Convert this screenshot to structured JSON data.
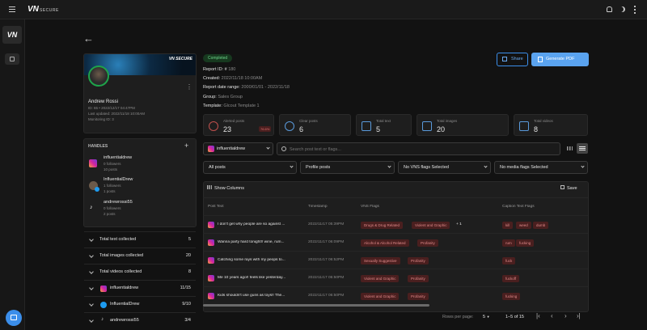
{
  "brand": {
    "logo": "VN",
    "sub": "SECURE"
  },
  "header": {
    "icons": [
      "bell-icon",
      "moon-icon",
      "menu-icon"
    ]
  },
  "nav": {
    "logo": "VN"
  },
  "report": {
    "status": "Completed",
    "id_label": "Report ID: #",
    "id": "180",
    "created_label": "Created:",
    "created": "2022/11/18 10:00AM",
    "range_label": "Report date range:",
    "range": "2000/01/01 - 2022/11/18",
    "group_label": "Group:",
    "group": "Sales Group",
    "template_label": "Template:",
    "template": "Glcout Template 1"
  },
  "buttons": {
    "share": "Share",
    "pdf": "Generate PDF"
  },
  "profile": {
    "banner_logo": "VN SECURE",
    "name": "Andrew Rossi",
    "id_line": "ID: 65 • 2022/12/17 04:47PM",
    "updated": "Last updated: 2022/11/18 10:00AM",
    "monitoring": "Monitoring ID: 3"
  },
  "handles": {
    "title": "HANDLES",
    "items": [
      {
        "name": "influentialdrew",
        "followers": "0 followers",
        "posts": "10 posts"
      },
      {
        "name": "InfluentialDrew",
        "followers": "1 followers",
        "posts": "1 posts"
      },
      {
        "name": "andrewrossi55",
        "followers": "0 followers",
        "posts": "2 posts"
      }
    ]
  },
  "summary": [
    {
      "label": "Total text collected",
      "value": "5"
    },
    {
      "label": "Total images collected",
      "value": "20"
    },
    {
      "label": "Total videos collected",
      "value": "8"
    },
    {
      "label": "influentialdrew",
      "value": "11/15"
    },
    {
      "label": "InfluentialDrew",
      "value": "9/10"
    },
    {
      "label": "andrewrossi55",
      "value": "3/4"
    }
  ],
  "stats": [
    {
      "label": "Alerted posts",
      "value": "23",
      "badge": "76.6%"
    },
    {
      "label": "Clear posts",
      "value": "6"
    },
    {
      "label": "Total text",
      "value": "5"
    },
    {
      "label": "Total images",
      "value": "20"
    },
    {
      "label": "Total videos",
      "value": "8"
    }
  ],
  "filters": {
    "account": "influentialdrew",
    "search_placeholder": "Search post text or flags...",
    "posts": "All posts",
    "profile": "Profile posts",
    "vns": "No VNS flags Selected",
    "media": "No media flags Selected"
  },
  "table": {
    "show_columns": "Show Columns",
    "save": "Save",
    "headers": [
      "Post Text",
      "Timestamp",
      "VNS Flags",
      "Caption Text Flags"
    ],
    "rows": [
      {
        "text": "I don't get why people are so against ...",
        "time": "2022/11/17 05:39PM",
        "vns": [
          "Drugs & Drug Related",
          "Violent and Graphic"
        ],
        "more": "+ 1",
        "caption": [
          "kill",
          "weed",
          "dumb"
        ]
      },
      {
        "text": "Wanna party hard tonight!! wine, rum...",
        "time": "2022/11/17 06:09PM",
        "vns": [
          "Alcohol & Alcohol Related",
          "Profanity"
        ],
        "more": "",
        "caption": [
          "rum",
          "fucking"
        ]
      },
      {
        "text": "Catching some rays with my peops to...",
        "time": "2022/11/17 06:52PM",
        "vns": [
          "Sexually Suggestive",
          "Profanity"
        ],
        "more": "",
        "caption": [
          "fuck"
        ]
      },
      {
        "text": "Me 10 years ago!! feels like yesterday...",
        "time": "2022/11/17 06:50PM",
        "vns": [
          "Violent and Graphic",
          "Profanity"
        ],
        "more": "",
        "caption": [
          "fuckoff"
        ]
      },
      {
        "text": "Kids shouldn't use guns as toys!! The...",
        "time": "2022/11/17 06:50PM",
        "vns": [
          "Violent and Graphic",
          "Profanity"
        ],
        "more": "",
        "caption": [
          "fucking"
        ]
      }
    ]
  },
  "pagination": {
    "rows_label": "Rows per page:",
    "rows": "5",
    "range": "1–5 of 15"
  }
}
